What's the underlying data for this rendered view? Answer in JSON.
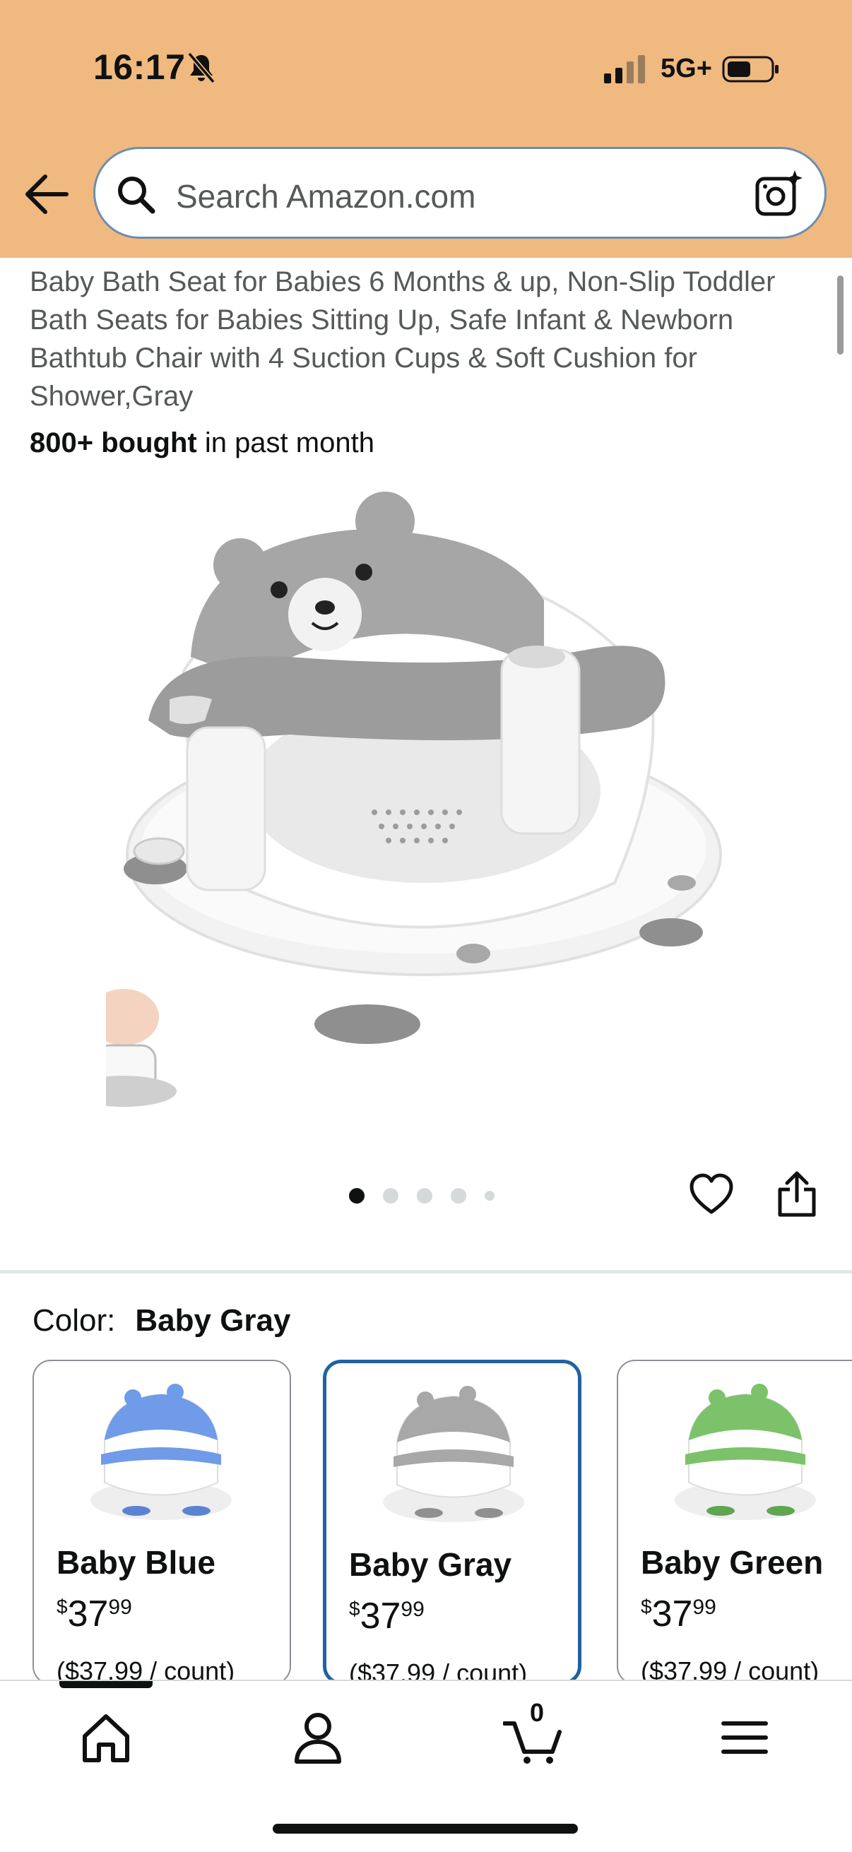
{
  "status_bar": {
    "time": "16:17",
    "network": "5G+"
  },
  "search": {
    "placeholder": "Search Amazon.com"
  },
  "product": {
    "title": "Baby Bath Seat for Babies 6 Months & up, Non-Slip Toddler Bath Seats for Babies Sitting Up, Safe Infant & Newborn Bathtub Chair with 4 Suction Cups & Soft Cushion for Shower,Gray",
    "bought_bold": "800+ bought",
    "bought_rest": " in past month",
    "image_count": 5,
    "active_image": 1
  },
  "color": {
    "label": "Color:",
    "selected": "Baby Gray",
    "options": [
      {
        "name": "Baby Blue",
        "currency": "$",
        "dollars": "37",
        "cents": "99",
        "unit": "($37.99 / count)",
        "color": "#6f9be8"
      },
      {
        "name": "Baby Gray",
        "currency": "$",
        "dollars": "37",
        "cents": "99",
        "unit": "($37.99 / count)",
        "color": "#a8a8a8"
      },
      {
        "name": "Baby Green",
        "currency": "$",
        "dollars": "37",
        "cents": "99",
        "unit": "($37.99 / count)",
        "color": "#7cc26a"
      }
    ]
  },
  "nav": {
    "cart_count": "0"
  },
  "colors": {
    "header": "#f0b97f",
    "selected_border": "#2162a1"
  }
}
